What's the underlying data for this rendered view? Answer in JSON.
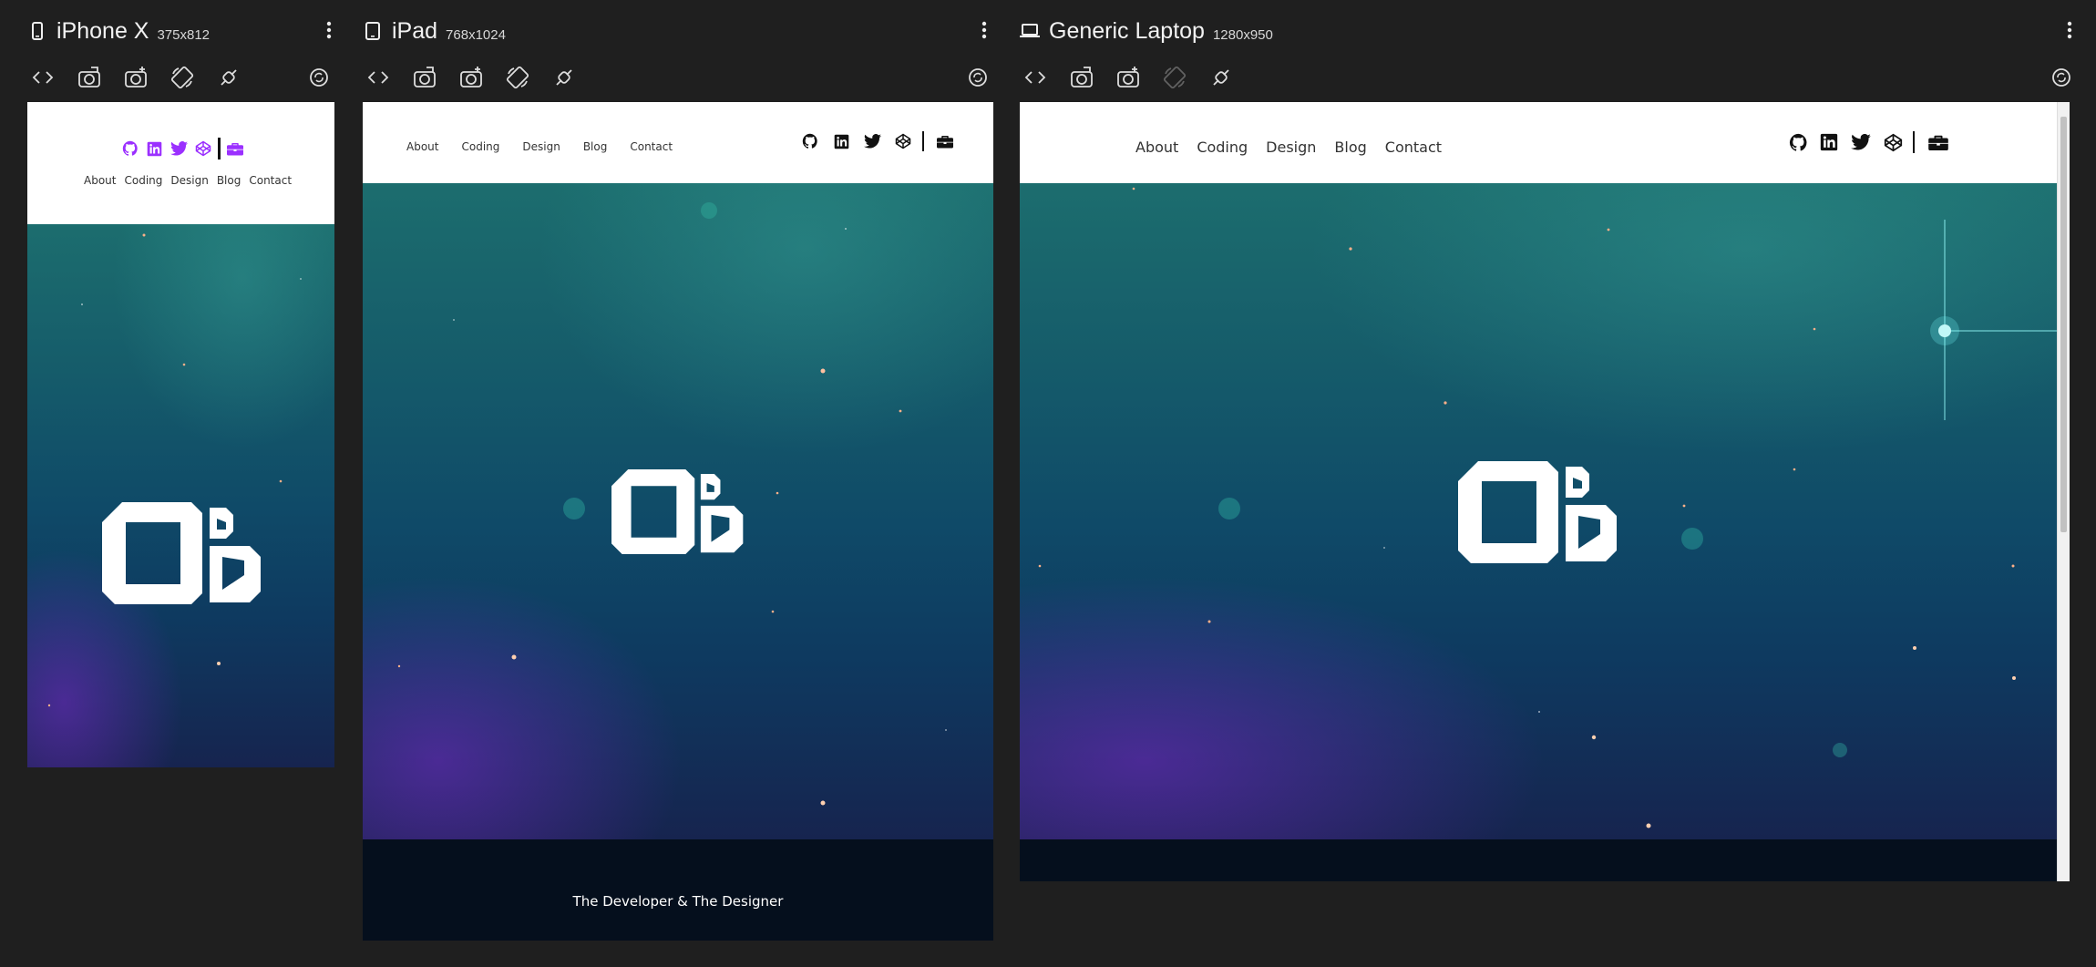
{
  "devices": [
    {
      "name": "iPhone X",
      "size": "375x812",
      "icon": "phone-icon",
      "nav": [
        "About",
        "Coding",
        "Design",
        "Blog",
        "Contact"
      ],
      "social_color": "#9b30ff"
    },
    {
      "name": "iPad",
      "size": "768x1024",
      "icon": "tablet-icon",
      "nav": [
        "About",
        "Coding",
        "Design",
        "Blog",
        "Contact"
      ],
      "footer_text": "The Developer & The Designer"
    },
    {
      "name": "Generic Laptop",
      "size": "1280x950",
      "icon": "laptop-icon",
      "nav": [
        "About",
        "Coding",
        "Design",
        "Blog",
        "Contact"
      ]
    }
  ],
  "toolbar_icons": [
    "code-icon",
    "screenshot-icon",
    "add-screenshot-icon",
    "rotate-icon",
    "no-interaction-icon",
    "sync-icon"
  ],
  "colors": {
    "app_bg": "#1f1f1f",
    "accent_purple": "#9b30ff",
    "hero_teal": "#1c6d6e",
    "hero_navy": "#0e3a60",
    "footer_bg": "#050f1d"
  }
}
